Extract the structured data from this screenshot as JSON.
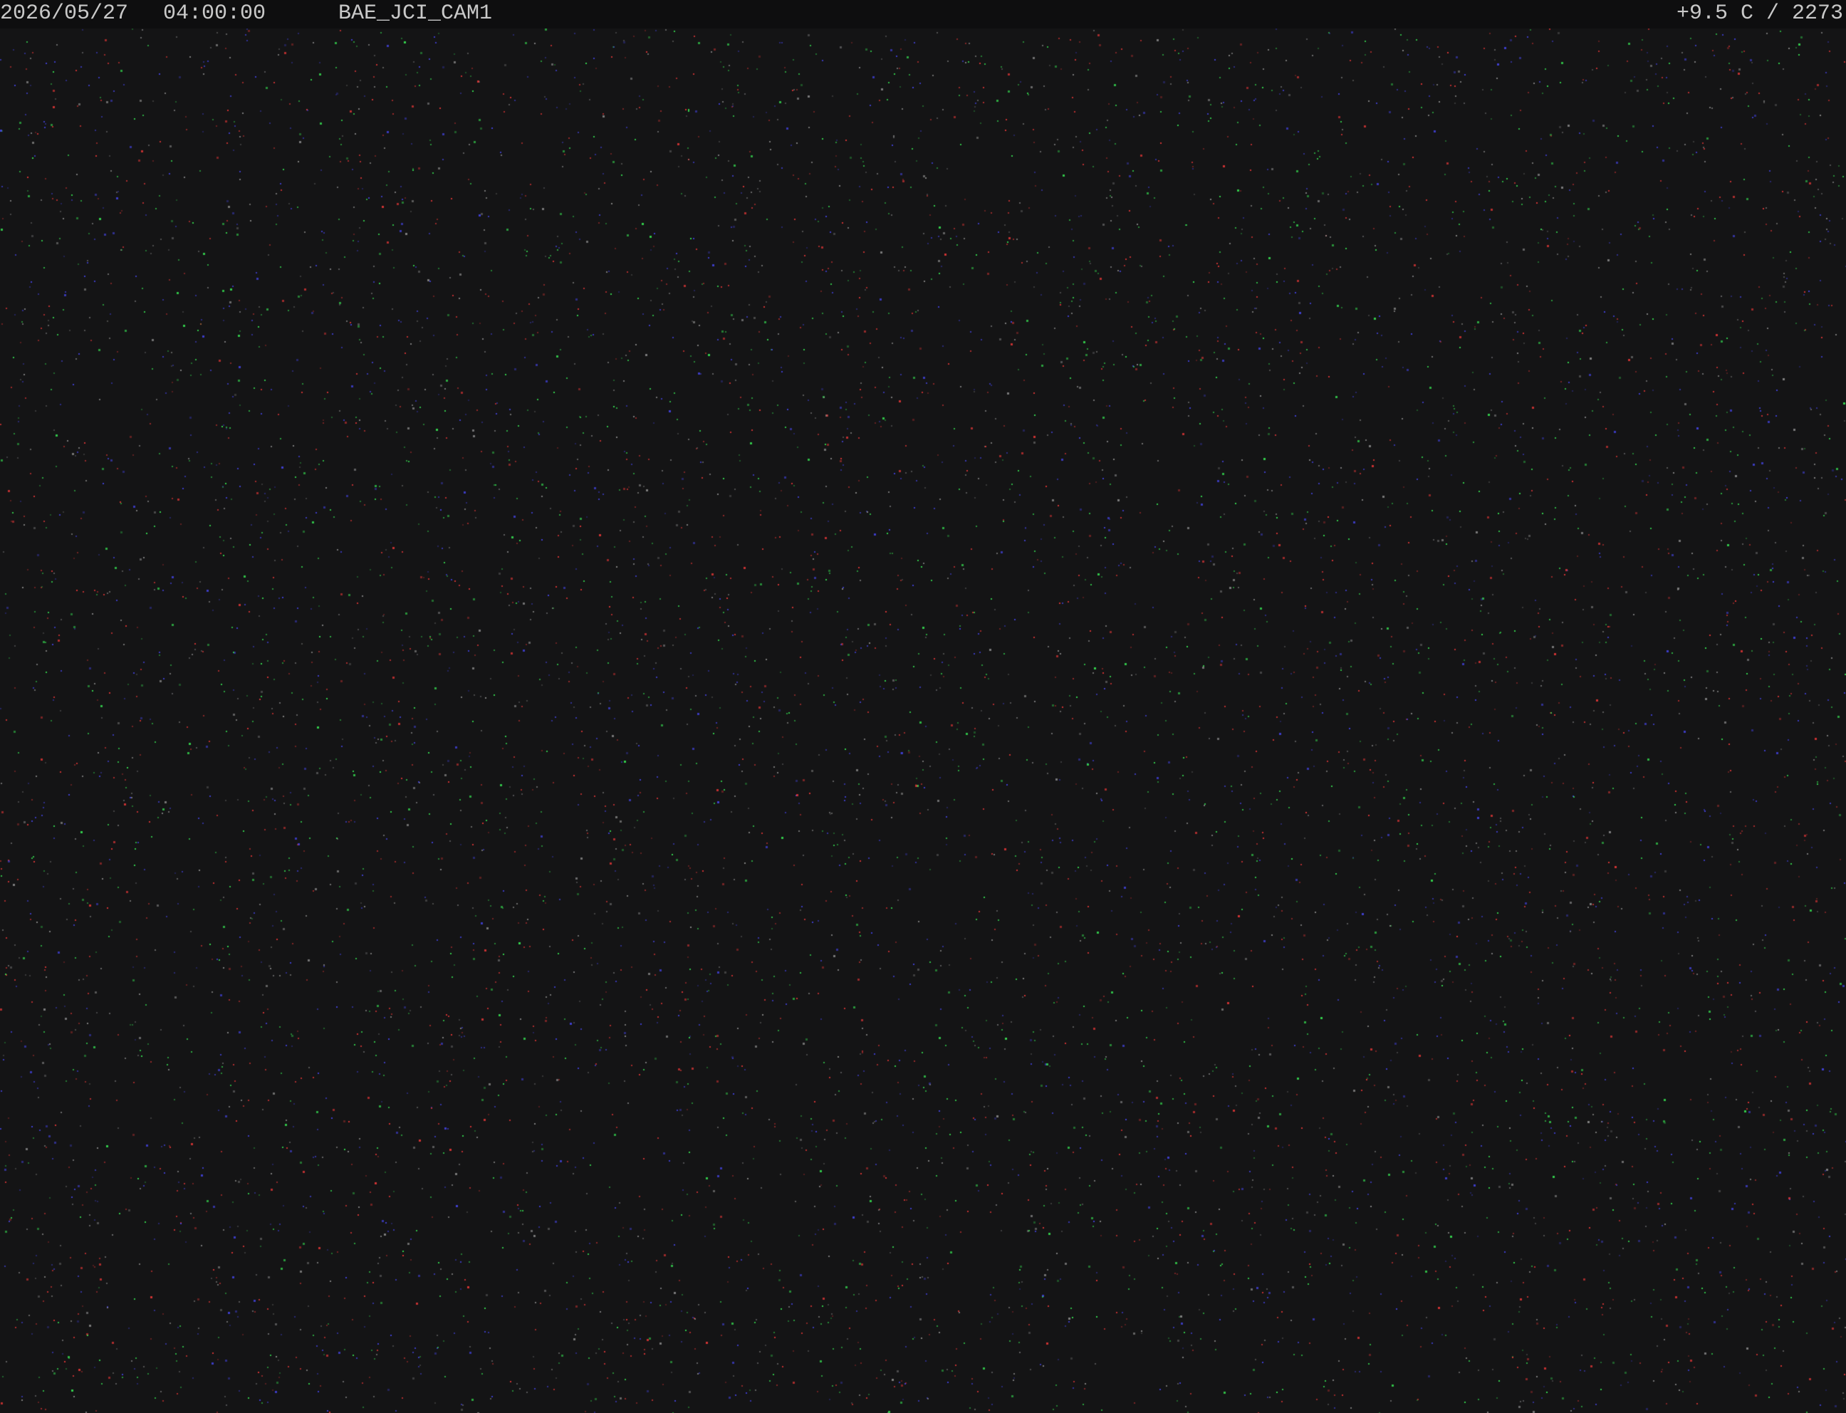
{
  "overlay": {
    "date": "2026/05/27",
    "time": "04:00:00",
    "camera_id": "BAE_JCI_CAM1",
    "temperature_counter": "+9.5 C / 2273"
  },
  "scene": {
    "description_type": "night sky camera frame, near-black with sensor noise",
    "background_color": "#141415",
    "noise_colors": [
      "#ff3b3b",
      "#3bff5a",
      "#4a4aff",
      "#9a9a9a"
    ]
  }
}
